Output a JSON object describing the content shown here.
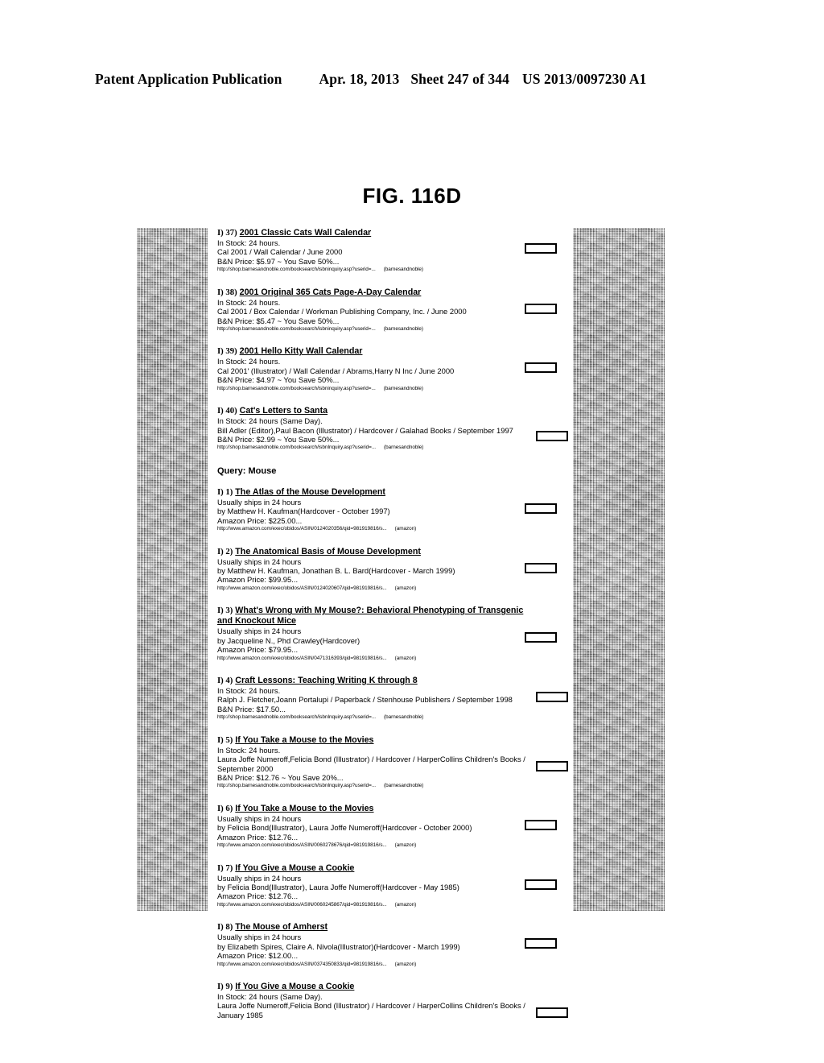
{
  "header": {
    "publication": "Patent Application Publication",
    "date": "Apr. 18, 2013",
    "sheet": "Sheet 247 of 344",
    "number": "US 2013/0097230 A1"
  },
  "figure": {
    "label": "FIG. 116D"
  },
  "query_heading": "Query: Mouse",
  "entries": [
    {
      "index": "I) 37)",
      "title": "2001 Classic Cats Wall Calendar",
      "availability": "In Stock: 24 hours.",
      "details": "Cal 2001 / Wall Calendar / June 2000",
      "price": "B&N Price: $5.97 ~ You Save 50%...",
      "url": "http://shop.barnesandnoble.com/booksearch/isbninquiry.asp?userid=...",
      "source": "(barnesandnoble)"
    },
    {
      "index": "I) 38)",
      "title": "2001 Original 365 Cats Page-A-Day Calendar",
      "availability": "In Stock: 24 hours.",
      "details": "Cal 2001 / Box Calendar / Workman Publishing Company, Inc. / June 2000",
      "price": "B&N Price: $5.47 ~ You Save 50%...",
      "url": "http://shop.barnesandnoble.com/booksearch/isbninquiry.asp?userid=...",
      "source": "(barnesandnoble)"
    },
    {
      "index": "I) 39)",
      "title": "2001 Hello Kitty Wall Calendar",
      "availability": "In Stock: 24 hours.",
      "details": "Cal 2001' (Illustrator) / Wall Calendar / Abrams,Harry N Inc / June 2000",
      "price": "B&N Price: $4.97 ~ You Save 50%...",
      "url": "http://shop.barnesandnoble.com/booksearch/isbninquiry.asp?userid=...",
      "source": "(barnesandnoble)"
    },
    {
      "index": "I) 40)",
      "title": "Cat's Letters to Santa",
      "availability": "In Stock: 24 hours (Same Day).",
      "details": "Bill Adler (Editor),Paul Bacon (Illustrator) / Hardcover / Galahad Books / September 1997",
      "price": "B&N Price: $2.99 ~ You Save 50%...",
      "url": "http://shop.barnesandnoble.com/booksearch/isbnInquiry.asp?userid=...",
      "source": "(barnesandnoble)"
    },
    {
      "index": "I) 1)",
      "title": "The Atlas of the Mouse Development",
      "availability": "Usually ships in 24 hours",
      "details": "by Matthew H. Kaufman(Hardcover - October 1997)",
      "price": "Amazon Price: $225.00...",
      "url": "http://www.amazon.com/exec/obidos/ASIN/0124020356/qid=981919816/s...",
      "source": "(amazon)"
    },
    {
      "index": "I) 2)",
      "title": "The Anatomical Basis of Mouse Development",
      "availability": "Usually ships in 24 hours",
      "details": "by Matthew H. Kaufman, Jonathan B. L. Bard(Hardcover - March 1999)",
      "price": "Amazon Price: $99.95...",
      "url": "http://www.amazon.com/exec/obidos/ASIN/0124020607/qid=981919816/s...",
      "source": "(amazon)"
    },
    {
      "index": "I) 3)",
      "title": "What's Wrong with My Mouse?: Behavioral Phenotyping of Transgenic and Knockout Mice",
      "availability": "Usually ships in 24 hours",
      "details": "by Jacqueline N., Phd Crawley(Hardcover)",
      "price": "Amazon Price: $79.95...",
      "url": "http://www.amazon.com/exec/obidos/ASIN/0471316393/qid=981919816/s...",
      "source": "(amazon)"
    },
    {
      "index": "I) 4)",
      "title": "Craft Lessons: Teaching Writing K through 8",
      "availability": "In Stock: 24 hours.",
      "details": "Ralph J. Fletcher,Joann Portalupi / Paperback / Stenhouse Publishers / September 1998",
      "price": "B&N Price: $17.50...",
      "url": "http://shop.barnesandnoble.com/booksearch/isbnInquiry.asp?userid=...",
      "source": "(barnesandnoble)"
    },
    {
      "index": "I) 5)",
      "title": "If You Take a Mouse to the Movies",
      "availability": "In Stock: 24 hours.",
      "details": "Laura Joffe Numeroff,Felicia Bond (Illustrator) / Hardcover / HarperCollins Children's Books / September 2000",
      "price": "B&N Price: $12.76 ~ You Save 20%...",
      "url": "http://shop.barnesandnoble.com/booksearch/isbnInquiry.asp?userid=...",
      "source": "(barnesandnoble)"
    },
    {
      "index": "I) 6)",
      "title": "If You Take a Mouse to the Movies",
      "availability": "Usually ships in 24 hours",
      "details": "by Felicia Bond(Illustrator), Laura Joffe Numeroff(Hardcover - October 2000)",
      "price": "Amazon Price: $12.76...",
      "url": "http://www.amazon.com/exec/obidos/ASIN/0060278676/qid=981919816/s...",
      "source": "(amazon)"
    },
    {
      "index": "I) 7)",
      "title": "If You Give a Mouse a Cookie",
      "availability": "Usually ships in 24 hours",
      "details": "by Felicia Bond(Illustrator), Laura Joffe Numeroff(Hardcover - May 1985)",
      "price": "Amazon Price: $12.76...",
      "url": "http://www.amazon.com/exec/obidos/ASIN/0060245867/qid=981919816/s...",
      "source": "(amazon)"
    },
    {
      "index": "I) 8)",
      "title": "The Mouse of Amherst",
      "availability": "Usually ships in 24 hours",
      "details": "by Elizabeth Spires, Claire A. Nivola(Illustrator)(Hardcover - March 1999)",
      "price": "Amazon Price: $12.00...",
      "url": "http://www.amazon.com/exec/obidos/ASIN/0374350833/qid=981919816/s...",
      "source": "(amazon)"
    },
    {
      "index": "I) 9)",
      "title": "If You Give a Mouse a Cookie",
      "availability": "In Stock: 24 hours (Same Day).",
      "details": "Laura Joffe Numeroff,Felicia Bond (Illustrator) / Hardcover / HarperCollins Children's Books / January 1985",
      "price": "",
      "url": "",
      "source": ""
    }
  ]
}
